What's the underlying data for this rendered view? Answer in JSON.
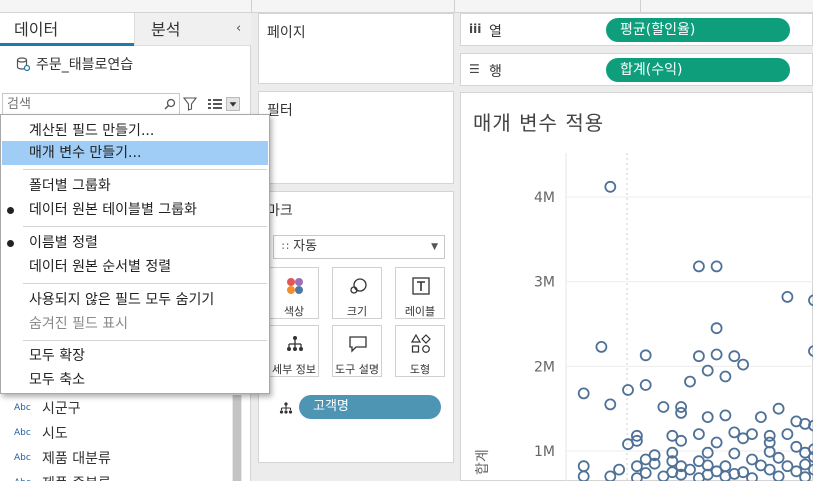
{
  "data_pane": {
    "tabs": [
      {
        "label": "데이터"
      },
      {
        "label": "분석"
      }
    ],
    "datasource": "주문_태블로연습",
    "search": {
      "placeholder": "검색",
      "value": ""
    },
    "fields": [
      {
        "type": "Abc",
        "name": "시군구"
      },
      {
        "type": "Abc",
        "name": "시도"
      },
      {
        "type": "Abc",
        "name": "제품 대분류"
      },
      {
        "type": "Abc",
        "name": "제품 중분류"
      }
    ]
  },
  "context_menu": {
    "items": [
      {
        "label": "계산된 필드 만들기...",
        "highlighted": false,
        "bullet": false,
        "disabled": false
      },
      {
        "label": "매개 변수 만들기...",
        "highlighted": true,
        "bullet": false,
        "disabled": false
      },
      {
        "label": "폴더별 그룹화",
        "highlighted": false,
        "bullet": false,
        "disabled": false
      },
      {
        "label": "데이터 원본 테이블별 그룹화",
        "highlighted": false,
        "bullet": true,
        "disabled": false
      },
      {
        "label": "이름별 정렬",
        "highlighted": false,
        "bullet": true,
        "disabled": false
      },
      {
        "label": "데이터 원본 순서별 정렬",
        "highlighted": false,
        "bullet": false,
        "disabled": false
      },
      {
        "label": "사용되지 않은 필드 모두 숨기기",
        "highlighted": false,
        "bullet": false,
        "disabled": false
      },
      {
        "label": "숨겨진 필드 표시",
        "highlighted": false,
        "bullet": false,
        "disabled": true
      },
      {
        "label": "모두 확장",
        "highlighted": false,
        "bullet": false,
        "disabled": false
      },
      {
        "label": "모두 축소",
        "highlighted": false,
        "bullet": false,
        "disabled": false
      }
    ]
  },
  "cards": {
    "pages": "페이지",
    "filters": "필터",
    "marks": {
      "title": "마크",
      "mark_type": "자동",
      "buttons": [
        {
          "label": "색상",
          "icon": "color-icon"
        },
        {
          "label": "크기",
          "icon": "size-icon"
        },
        {
          "label": "레이블",
          "icon": "label-icon"
        },
        {
          "label": "세부 정보",
          "icon": "detail-icon"
        },
        {
          "label": "도구 설명",
          "icon": "tooltip-icon"
        },
        {
          "label": "도형",
          "icon": "shape-icon"
        }
      ],
      "detail_pill": "고객명"
    }
  },
  "shelves": {
    "columns": {
      "icon": "iii",
      "label": "열",
      "pill": "평균(할인율)"
    },
    "rows": {
      "icon": "☰",
      "label": "행",
      "pill": "합계(수익)"
    }
  },
  "colors": {
    "accent": "#1f77b4",
    "measure_pill": "#0e9e7c",
    "dimension_pill": "#4e95b3",
    "menu_highlight": "#9fcdf5",
    "mark_stroke": "#4f7197"
  },
  "chart_data": {
    "type": "scatter",
    "title": "매개 변수 적용",
    "ylabel": "합계",
    "yticks": [
      "4M",
      "3M",
      "2M",
      "1M"
    ],
    "ytick_values": [
      4,
      3,
      2,
      1
    ],
    "ylim": [
      0.55,
      4.5
    ],
    "xlim": [
      0.07,
      0.35
    ],
    "grid": true,
    "points": [
      [
        0.12,
        4.12
      ],
      [
        0.22,
        3.18
      ],
      [
        0.24,
        3.18
      ],
      [
        0.32,
        2.82
      ],
      [
        0.35,
        2.78
      ],
      [
        0.24,
        2.45
      ],
      [
        0.11,
        2.23
      ],
      [
        0.16,
        2.13
      ],
      [
        0.24,
        2.14
      ],
      [
        0.26,
        2.12
      ],
      [
        0.35,
        2.18
      ],
      [
        0.22,
        2.12
      ],
      [
        0.27,
        2.02
      ],
      [
        0.23,
        1.95
      ],
      [
        0.25,
        1.88
      ],
      [
        0.21,
        1.82
      ],
      [
        0.14,
        1.72
      ],
      [
        0.16,
        1.78
      ],
      [
        0.09,
        1.68
      ],
      [
        0.12,
        1.55
      ],
      [
        0.18,
        1.52
      ],
      [
        0.2,
        1.52
      ],
      [
        0.31,
        1.5
      ],
      [
        0.2,
        1.45
      ],
      [
        0.23,
        1.4
      ],
      [
        0.25,
        1.42
      ],
      [
        0.29,
        1.4
      ],
      [
        0.33,
        1.35
      ],
      [
        0.34,
        1.32
      ],
      [
        0.35,
        1.3
      ],
      [
        0.19,
        1.18
      ],
      [
        0.22,
        1.2
      ],
      [
        0.26,
        1.22
      ],
      [
        0.28,
        1.2
      ],
      [
        0.3,
        1.18
      ],
      [
        0.32,
        1.2
      ],
      [
        0.15,
        1.18
      ],
      [
        0.15,
        1.12
      ],
      [
        0.14,
        1.08
      ],
      [
        0.2,
        1.12
      ],
      [
        0.24,
        1.1
      ],
      [
        0.27,
        1.15
      ],
      [
        0.3,
        1.1
      ],
      [
        0.33,
        1.05
      ],
      [
        0.35,
        1.02
      ],
      [
        0.17,
        0.95
      ],
      [
        0.19,
        0.98
      ],
      [
        0.23,
        0.98
      ],
      [
        0.26,
        0.97
      ],
      [
        0.3,
        0.99
      ],
      [
        0.34,
        0.98
      ],
      [
        0.16,
        0.9
      ],
      [
        0.19,
        0.88
      ],
      [
        0.22,
        0.88
      ],
      [
        0.28,
        0.9
      ],
      [
        0.31,
        0.92
      ],
      [
        0.35,
        0.93
      ],
      [
        0.15,
        0.82
      ],
      [
        0.17,
        0.85
      ],
      [
        0.2,
        0.82
      ],
      [
        0.23,
        0.83
      ],
      [
        0.25,
        0.82
      ],
      [
        0.29,
        0.83
      ],
      [
        0.32,
        0.82
      ],
      [
        0.34,
        0.84
      ],
      [
        0.09,
        0.82
      ],
      [
        0.09,
        0.7
      ],
      [
        0.13,
        0.78
      ],
      [
        0.16,
        0.74
      ],
      [
        0.19,
        0.75
      ],
      [
        0.21,
        0.78
      ],
      [
        0.24,
        0.76
      ],
      [
        0.27,
        0.75
      ],
      [
        0.3,
        0.78
      ],
      [
        0.33,
        0.76
      ],
      [
        0.35,
        0.78
      ],
      [
        0.12,
        0.7
      ],
      [
        0.15,
        0.68
      ],
      [
        0.18,
        0.7
      ],
      [
        0.22,
        0.68
      ],
      [
        0.25,
        0.7
      ],
      [
        0.28,
        0.68
      ],
      [
        0.31,
        0.7
      ],
      [
        0.34,
        0.69
      ],
      [
        0.2,
        0.72
      ],
      [
        0.26,
        0.73
      ],
      [
        0.23,
        0.72
      ]
    ]
  }
}
